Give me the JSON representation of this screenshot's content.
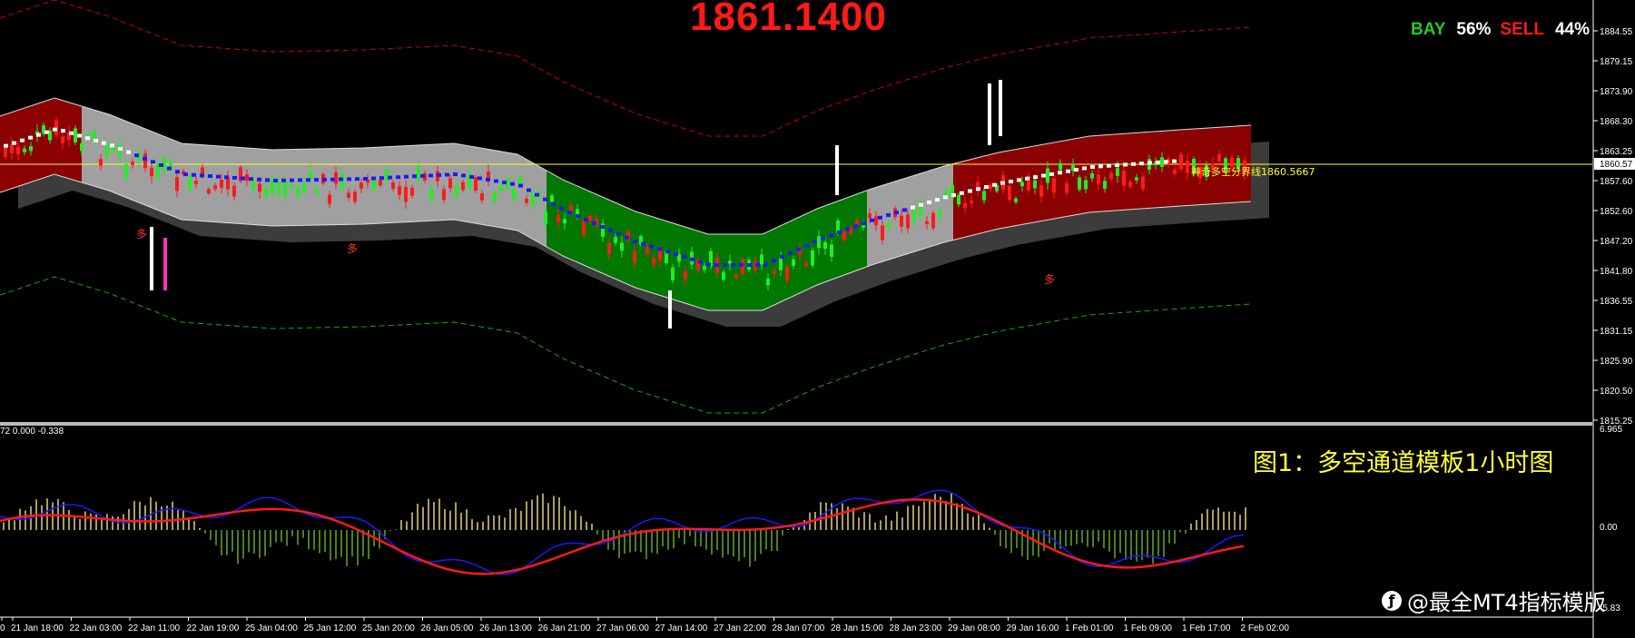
{
  "header": {
    "current_price": "1861.1400",
    "bay_label": "BAY",
    "bay_pct": "56%",
    "sell_label": "SELL",
    "sell_pct": "44%"
  },
  "price_axis": {
    "labels": [
      "1884.55",
      "1879.15",
      "1873.90",
      "1868.30",
      "1863.25",
      "1857.60",
      "1852.60",
      "1847.20",
      "1841.80",
      "1836.55",
      "1831.15",
      "1825.90",
      "1820.50",
      "1815.25"
    ],
    "current_tag": "1860.57"
  },
  "oscillator_axis": {
    "labels": [
      "6.965",
      "0.00",
      "-5.83"
    ]
  },
  "oscillator": {
    "info": "72 0.000 -0.338"
  },
  "pivot": {
    "label": "神奇多空分界线1860.5667"
  },
  "markers": {
    "duo": "多"
  },
  "time_axis": {
    "labels": [
      "0",
      "21 Jan 18:00",
      "22 Jan 03:00",
      "22 Jan 11:00",
      "22 Jan 19:00",
      "25 Jan 04:00",
      "25 Jan 12:00",
      "25 Jan 20:00",
      "26 Jan 05:00",
      "26 Jan 13:00",
      "26 Jan 21:00",
      "27 Jan 06:00",
      "27 Jan 14:00",
      "27 Jan 22:00",
      "28 Jan 07:00",
      "28 Jan 15:00",
      "28 Jan 23:00",
      "29 Jan 08:00",
      "29 Jan 16:00",
      "1 Feb 01:00",
      "1 Feb 09:00",
      "1 Feb 17:00",
      "2 Feb 02:00"
    ]
  },
  "caption": "图1：多空通道模板1小时图",
  "watermark": "@最全MT4指标模版",
  "colors": {
    "bull_candle": "#22ee22",
    "bear_candle": "#ff1a1a",
    "zone_bull": "#007700",
    "zone_bear": "#8b0000",
    "zone_neutral": "#a0a0a0",
    "trend_down": "#1a1aff",
    "trend_up": "#ffffff",
    "outer_band_upper": "#cc0000",
    "outer_band_lower": "#11aa11",
    "pivot_line": "#ffff33",
    "macd_signal": "#ff1a1a",
    "macd_line": "#1a1aff"
  }
}
